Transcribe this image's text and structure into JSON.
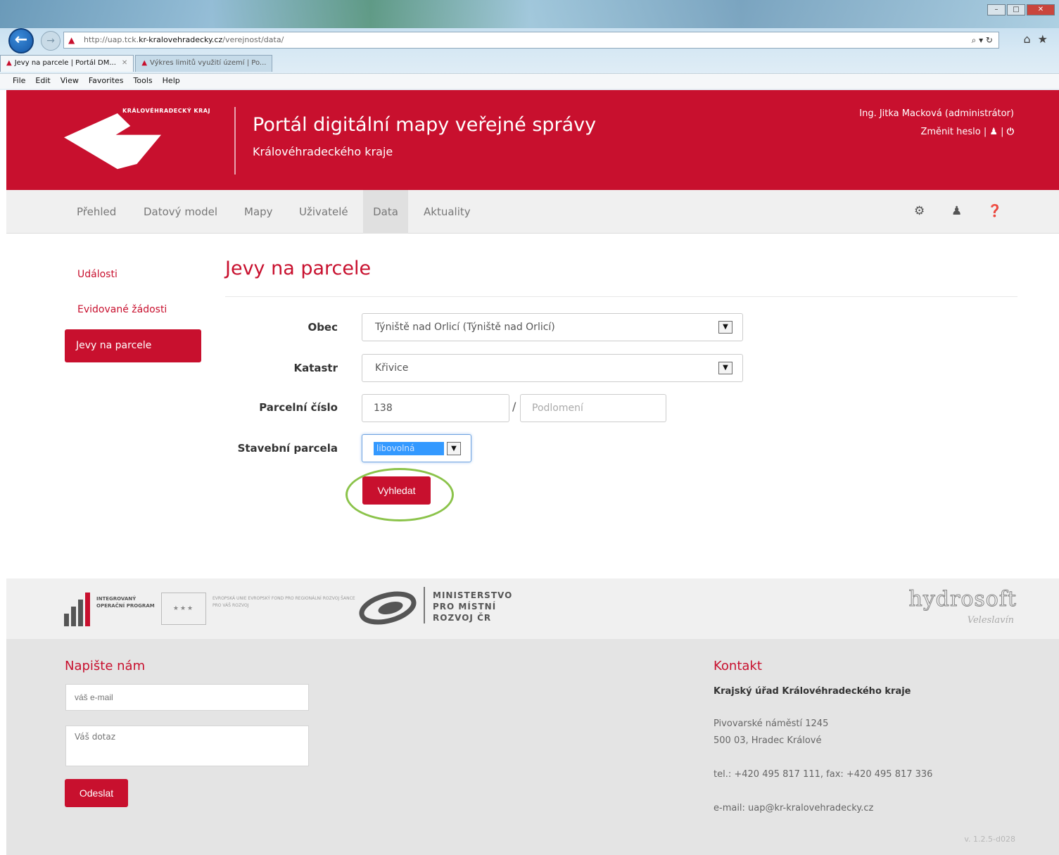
{
  "browser": {
    "url_prefix": "http://uap.tck.",
    "url_host": "kr-kralovehradecky.cz",
    "url_path": "/verejnost/data/",
    "address_tools": "⌕ ▾ ↻",
    "tabs": [
      {
        "label": "Jevy na parcele | Portál DM...",
        "active": true
      },
      {
        "label": "Výkres limitů využití území | Po...",
        "active": false
      }
    ],
    "menu": [
      {
        "label": "File"
      },
      {
        "label": "Edit"
      },
      {
        "label": "View"
      },
      {
        "label": "Favorites"
      },
      {
        "label": "Tools"
      },
      {
        "label": "Help"
      }
    ]
  },
  "header": {
    "logo_text": "KRÁLOVÉHRADECKÝ KRAJ",
    "title": "Portál digitální mapy veřejné správy",
    "subtitle": "Královéhradeckého kraje",
    "user": "Ing. Jitka Macková (administrátor)",
    "change_password": "Změnit heslo",
    "separator": "|"
  },
  "nav": {
    "items": [
      {
        "label": "Přehled"
      },
      {
        "label": "Datový model"
      },
      {
        "label": "Mapy"
      },
      {
        "label": "Uživatelé"
      },
      {
        "label": "Data"
      },
      {
        "label": "Aktuality"
      }
    ],
    "active": "Data"
  },
  "sidebar": {
    "items": [
      {
        "label": "Události"
      },
      {
        "label": "Evidované žádosti"
      },
      {
        "label": "Jevy na parcele"
      }
    ]
  },
  "form": {
    "title": "Jevy na parcele",
    "obec_label": "Obec",
    "obec_value": "Týniště nad Orlicí (Týniště nad Orlicí)",
    "katastr_label": "Katastr",
    "katastr_value": "Křivice",
    "parcel_label": "Parcelní číslo",
    "parcel_value": "138",
    "parcel_separator": "/",
    "subdiv_placeholder": "Podlomení",
    "stavebni_label": "Stavební parcela",
    "stavebni_value": "libovolná",
    "search_button": "Vyhledat"
  },
  "partners": {
    "iop_text": "INTEGROVANÝ OPERAČNÍ PROGRAM",
    "eu_text": "EVROPSKÁ UNIE EVROPSKÝ FOND PRO REGIONÁLNÍ ROZVOJ ŠANCE PRO VÁŠ ROZVOJ",
    "ministry": [
      "MINISTERSTVO",
      "PRO MÍSTNÍ",
      "ROZVOJ ČR"
    ],
    "hydrosoft": "hydrosoft",
    "hydrosoft_sub": "Veleslavín"
  },
  "footer": {
    "write_us": "Napište nám",
    "email_placeholder": "váš e-mail",
    "question_placeholder": "Váš dotaz",
    "send_button": "Odeslat",
    "contact_head": "Kontakt",
    "org": "Krajský úřad Královéhradeckého kraje",
    "address1": "Pivovarské náměstí 1245",
    "address2": "500 03, Hradec Králové",
    "phone": "tel.: +420 495 817 111, fax: +420 495 817 336",
    "email": "e-mail: uap@kr-kralovehradecky.cz",
    "version": "v. 1.2.5-d028"
  },
  "colors": {
    "brand_red": "#c8102e",
    "highlight_green": "#8bc34a",
    "selection_blue": "#3399ff"
  },
  "icons": {
    "nav_right": [
      "gear-icon",
      "user-icon",
      "help-icon"
    ],
    "header_right": [
      "user-icon",
      "power-icon"
    ]
  }
}
